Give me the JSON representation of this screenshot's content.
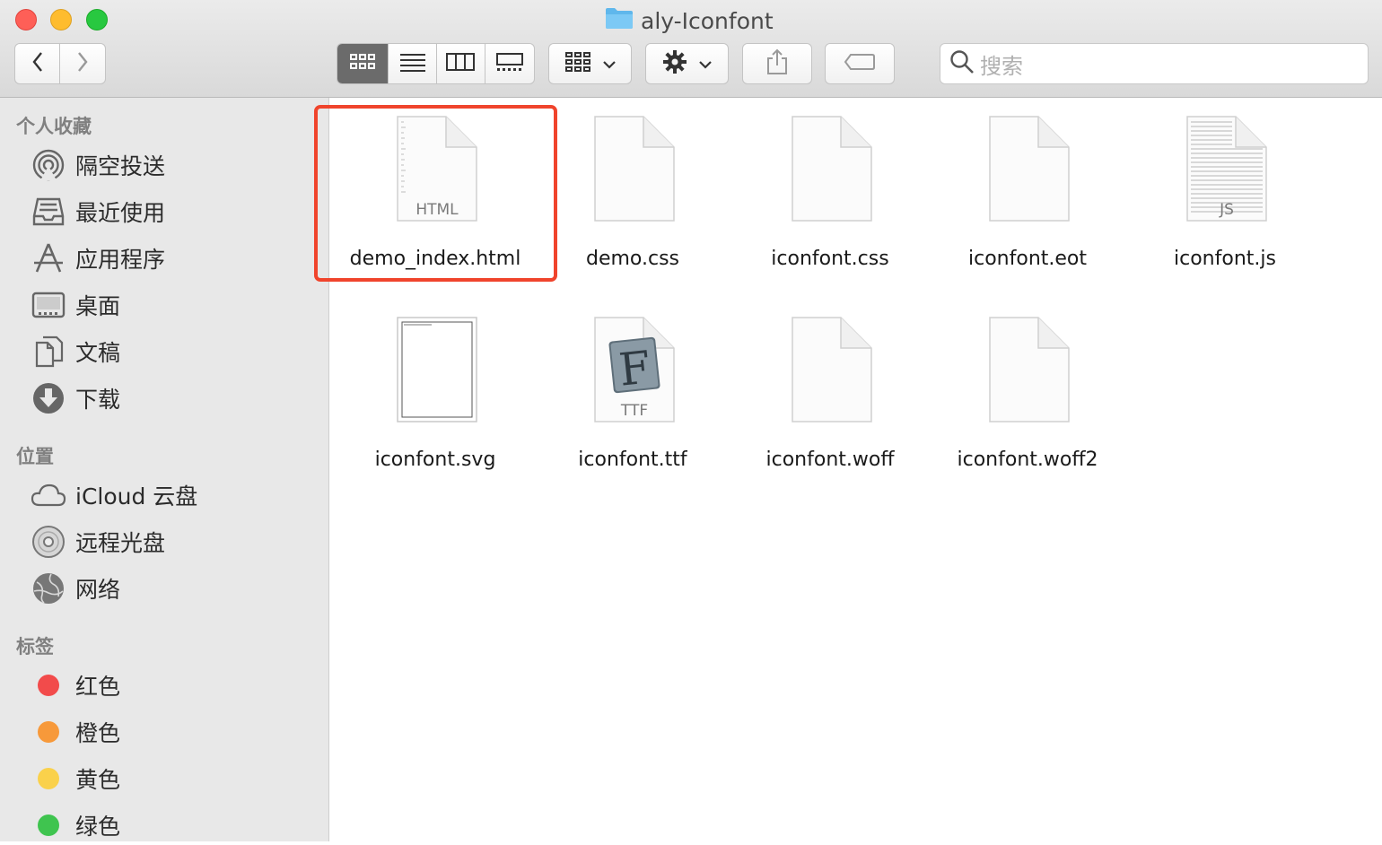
{
  "window": {
    "title": "aly-Iconfont"
  },
  "toolbar": {
    "back_icon": "chevron-left-icon",
    "forward_icon": "chevron-right-icon",
    "view_modes": [
      "icon-view",
      "list-view",
      "column-view",
      "gallery-view"
    ],
    "active_view": "icon-view",
    "group_icon": "group-grid-icon",
    "action_icon": "gear-icon",
    "share_icon": "share-icon",
    "tag_icon": "tag-icon",
    "search_placeholder": "搜索"
  },
  "sidebar": {
    "favorites_header": "个人收藏",
    "favorites": [
      {
        "label": "隔空投送",
        "icon": "airdrop-icon"
      },
      {
        "label": "最近使用",
        "icon": "recents-icon"
      },
      {
        "label": "应用程序",
        "icon": "applications-icon"
      },
      {
        "label": "桌面",
        "icon": "desktop-icon"
      },
      {
        "label": "文稿",
        "icon": "documents-icon"
      },
      {
        "label": "下载",
        "icon": "downloads-icon"
      }
    ],
    "locations_header": "位置",
    "locations": [
      {
        "label": "iCloud 云盘",
        "icon": "icloud-icon"
      },
      {
        "label": "远程光盘",
        "icon": "remote-disc-icon"
      },
      {
        "label": "网络",
        "icon": "network-icon"
      }
    ],
    "tags_header": "标签",
    "tags": [
      {
        "label": "红色",
        "color": "#f24b4b"
      },
      {
        "label": "橙色",
        "color": "#f7993a"
      },
      {
        "label": "黄色",
        "color": "#fad14b"
      },
      {
        "label": "绿色",
        "color": "#3fc44f"
      }
    ]
  },
  "files": [
    {
      "name": "demo_index.html",
      "type_label": "HTML",
      "selected": true
    },
    {
      "name": "demo.css",
      "type_label": ""
    },
    {
      "name": "iconfont.css",
      "type_label": ""
    },
    {
      "name": "iconfont.eot",
      "type_label": ""
    },
    {
      "name": "iconfont.js",
      "type_label": "JS"
    },
    {
      "name": "iconfont.svg",
      "type_label": ""
    },
    {
      "name": "iconfont.ttf",
      "type_label": "TTF"
    },
    {
      "name": "iconfont.woff",
      "type_label": ""
    },
    {
      "name": "iconfont.woff2",
      "type_label": ""
    }
  ],
  "highlight_color": "#f0442c"
}
